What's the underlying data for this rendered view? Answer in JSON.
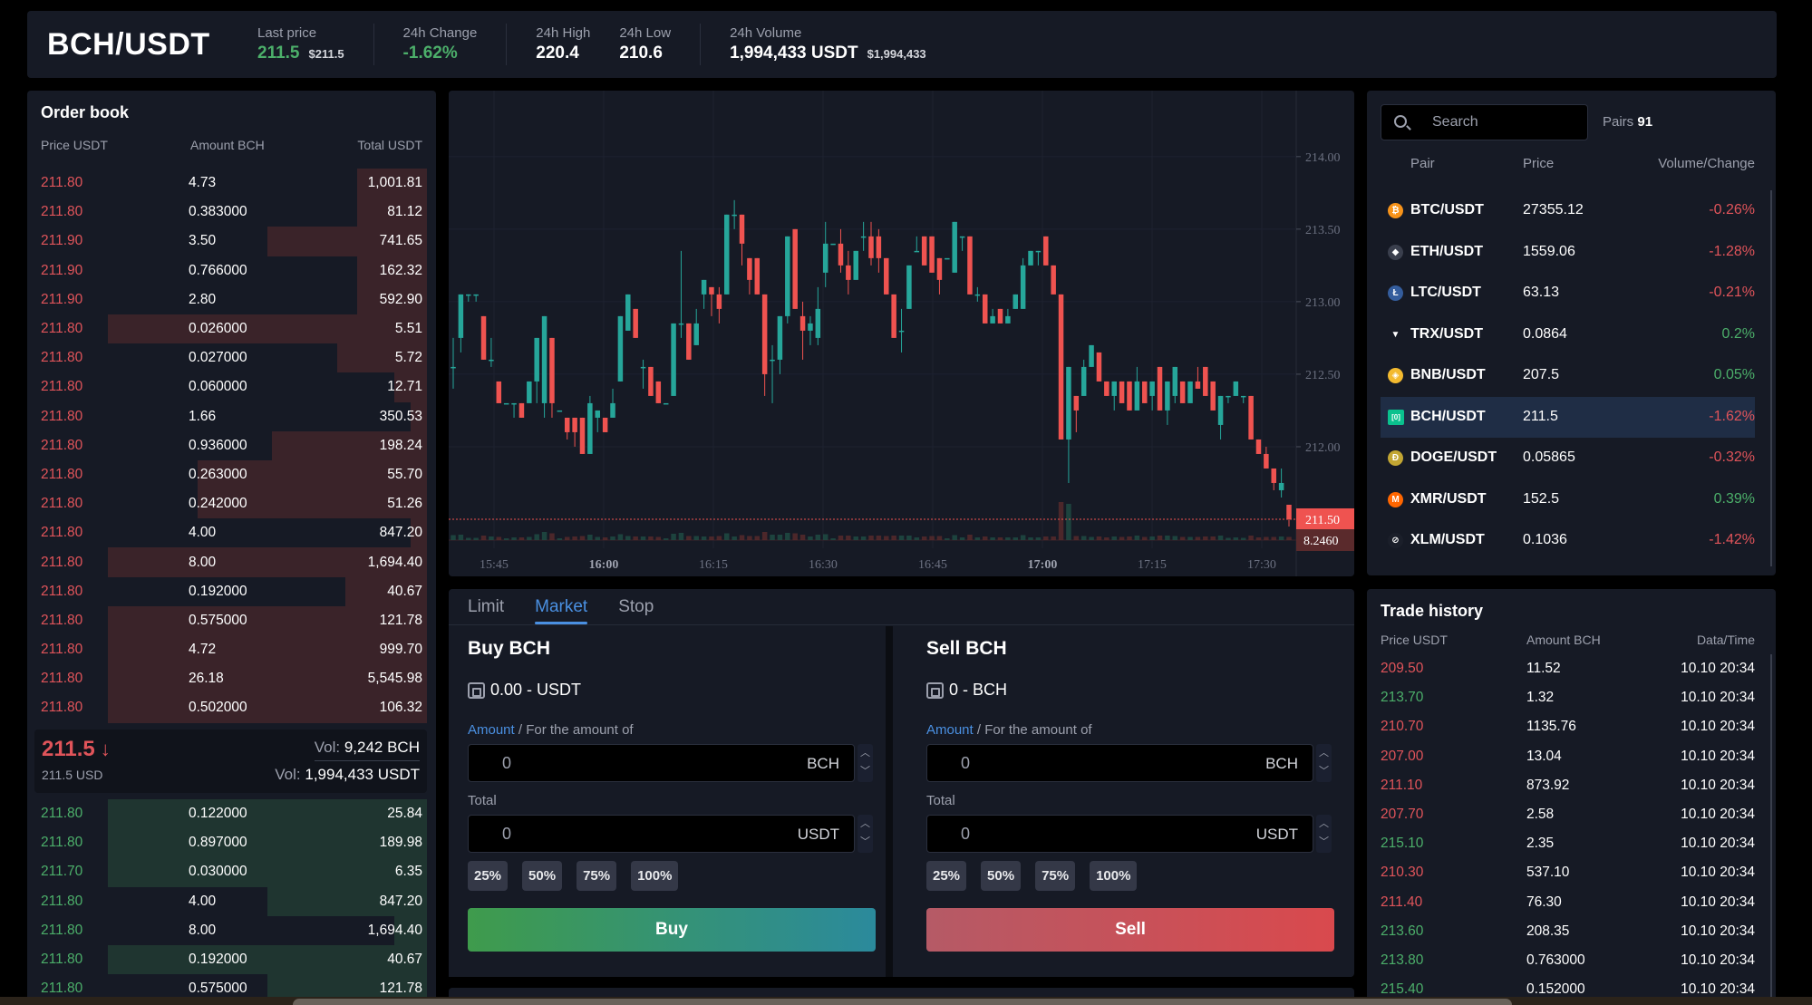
{
  "header": {
    "pair": "BCH/USDT",
    "stats": [
      {
        "label": "Last price",
        "value": "211.5",
        "sub": "$211.5",
        "color": "green"
      },
      {
        "label": "24h Change",
        "value": "-1.62%",
        "sub": "",
        "color": "green"
      },
      {
        "label": "24h High",
        "value": "220.4",
        "sub": "",
        "color": ""
      },
      {
        "label": "24h Low",
        "value": "210.6",
        "sub": "",
        "color": ""
      },
      {
        "label": "24h Volume",
        "value": "1,994,433 USDT",
        "sub": "$1,994,433",
        "color": ""
      }
    ]
  },
  "orderbook": {
    "title": "Order book",
    "columns": [
      "Price USDT",
      "Amount BCH",
      "Total USDT"
    ],
    "asks": [
      {
        "price": "211.80",
        "amount": "4.73",
        "total": "1,001.81",
        "depth": 0.17
      },
      {
        "price": "211.80",
        "amount": "0.383000",
        "total": "81.12",
        "depth": 0.17
      },
      {
        "price": "211.90",
        "amount": "3.50",
        "total": "741.65",
        "depth": 0.39
      },
      {
        "price": "211.90",
        "amount": "0.766000",
        "total": "162.32",
        "depth": 0.17
      },
      {
        "price": "211.90",
        "amount": "2.80",
        "total": "592.90",
        "depth": 0.17
      },
      {
        "price": "211.80",
        "amount": "0.026000",
        "total": "5.51",
        "depth": 0.78
      },
      {
        "price": "211.80",
        "amount": "0.027000",
        "total": "5.72",
        "depth": 0.22
      },
      {
        "price": "211.80",
        "amount": "0.060000",
        "total": "12.71",
        "depth": 0.08
      },
      {
        "price": "211.80",
        "amount": "1.66",
        "total": "350.53",
        "depth": 0.04
      },
      {
        "price": "211.80",
        "amount": "0.936000",
        "total": "198.24",
        "depth": 0.38
      },
      {
        "price": "211.80",
        "amount": "0.263000",
        "total": "55.70",
        "depth": 0.56
      },
      {
        "price": "211.80",
        "amount": "0.242000",
        "total": "51.26",
        "depth": 0.56
      },
      {
        "price": "211.80",
        "amount": "4.00",
        "total": "847.20",
        "depth": 0.04
      },
      {
        "price": "211.80",
        "amount": "8.00",
        "total": "1,694.40",
        "depth": 0.78
      },
      {
        "price": "211.80",
        "amount": "0.192000",
        "total": "40.67",
        "depth": 0.2
      },
      {
        "price": "211.80",
        "amount": "0.575000",
        "total": "121.78",
        "depth": 0.78
      },
      {
        "price": "211.80",
        "amount": "4.72",
        "total": "999.70",
        "depth": 0.78
      },
      {
        "price": "211.80",
        "amount": "26.18",
        "total": "5,545.98",
        "depth": 0.78
      },
      {
        "price": "211.80",
        "amount": "0.502000",
        "total": "106.32",
        "depth": 0.78
      }
    ],
    "mid": {
      "price": "211.5",
      "arrow": "↓",
      "usd": "211.5 USD",
      "vol_label": "Vol:",
      "vol_base": "9,242 BCH",
      "vol_quote": "1,994,433 USDT"
    },
    "bids": [
      {
        "price": "211.80",
        "amount": "0.122000",
        "total": "25.84",
        "depth": 0.78
      },
      {
        "price": "211.80",
        "amount": "0.897000",
        "total": "189.98",
        "depth": 0.78
      },
      {
        "price": "211.70",
        "amount": "0.030000",
        "total": "6.35",
        "depth": 0.78
      },
      {
        "price": "211.80",
        "amount": "4.00",
        "total": "847.20",
        "depth": 0.39
      },
      {
        "price": "211.80",
        "amount": "8.00",
        "total": "1,694.40",
        "depth": 0.08
      },
      {
        "price": "211.80",
        "amount": "0.192000",
        "total": "40.67",
        "depth": 0.78
      },
      {
        "price": "211.80",
        "amount": "0.575000",
        "total": "121.78",
        "depth": 0.39
      }
    ]
  },
  "chart_data": {
    "type": "candlestick",
    "title": "BCH/USDT",
    "x_ticks": [
      "15:45",
      "16:00",
      "16:15",
      "16:30",
      "16:45",
      "17:00",
      "17:15",
      "17:30"
    ],
    "y_ticks": [
      "214.00",
      "213.50",
      "213.00",
      "212.50",
      "212.00"
    ],
    "ylim": [
      211.3,
      214.3
    ],
    "last_price_label": "211.50",
    "last_price": 211.5,
    "volume_label": "8.2460",
    "up_color": "#26a69a",
    "down_color": "#ef5350",
    "candles": [
      [
        212.55,
        212.75,
        212.55,
        212.4
      ],
      [
        212.75,
        213.05,
        213.05,
        212.65
      ],
      [
        213.05,
        213.05,
        213.05,
        213.0
      ],
      [
        213.05,
        213.05,
        213.05,
        213.0
      ],
      [
        212.9,
        212.9,
        212.6,
        212.6
      ],
      [
        212.6,
        212.75,
        212.6,
        212.55
      ],
      [
        212.45,
        212.45,
        212.3,
        212.3
      ],
      [
        212.3,
        212.3,
        212.3,
        212.3
      ],
      [
        212.3,
        212.3,
        212.3,
        212.2
      ],
      [
        212.3,
        212.3,
        212.2,
        212.2
      ],
      [
        212.3,
        212.45,
        212.45,
        212.3
      ],
      [
        212.45,
        212.6,
        212.75,
        212.3
      ],
      [
        212.3,
        212.9,
        212.9,
        212.2
      ],
      [
        212.75,
        212.75,
        212.3,
        212.2
      ],
      [
        212.25,
        212.25,
        212.25,
        212.25
      ],
      [
        212.2,
        212.2,
        212.1,
        212.05
      ],
      [
        212.2,
        212.2,
        212.1,
        212.0
      ],
      [
        212.2,
        212.2,
        211.95,
        211.95
      ],
      [
        211.95,
        212.35,
        212.3,
        211.95
      ],
      [
        212.2,
        212.2,
        212.25,
        212.1
      ],
      [
        212.2,
        212.2,
        212.1,
        212.1
      ],
      [
        212.2,
        212.4,
        212.3,
        212.2
      ],
      [
        212.45,
        212.8,
        212.9,
        212.45
      ],
      [
        212.8,
        212.95,
        213.05,
        212.8
      ],
      [
        212.95,
        212.95,
        212.75,
        212.75
      ],
      [
        212.55,
        212.6,
        212.55,
        212.4
      ],
      [
        212.55,
        212.55,
        212.35,
        212.35
      ],
      [
        212.45,
        212.45,
        212.3,
        212.3
      ],
      [
        212.3,
        212.3,
        212.3,
        212.3
      ],
      [
        212.35,
        212.85,
        212.85,
        212.35
      ],
      [
        212.85,
        213.35,
        212.85,
        212.75
      ],
      [
        212.85,
        212.85,
        212.6,
        212.6
      ],
      [
        212.7,
        212.95,
        212.85,
        212.7
      ],
      [
        213.05,
        213.05,
        213.15,
        212.95
      ],
      [
        213.1,
        213.1,
        213.05,
        212.9
      ],
      [
        213.05,
        213.1,
        212.95,
        212.85
      ],
      [
        213.05,
        213.6,
        213.6,
        213.05
      ],
      [
        213.6,
        213.7,
        213.6,
        213.5
      ],
      [
        213.6,
        213.6,
        213.4,
        213.25
      ],
      [
        213.3,
        213.3,
        213.15,
        213.05
      ],
      [
        213.3,
        213.3,
        213.05,
        213.05
      ],
      [
        213.05,
        213.05,
        212.5,
        212.35
      ],
      [
        212.6,
        212.7,
        212.6,
        212.3
      ],
      [
        212.6,
        212.6,
        212.9,
        212.5
      ],
      [
        212.9,
        213.45,
        213.45,
        212.85
      ],
      [
        213.5,
        213.5,
        212.95,
        212.95
      ],
      [
        212.9,
        213.0,
        212.8,
        212.6
      ],
      [
        212.8,
        212.9,
        212.85,
        212.7
      ],
      [
        212.75,
        213.1,
        212.95,
        212.7
      ],
      [
        213.2,
        213.55,
        213.4,
        213.1
      ],
      [
        213.4,
        213.4,
        213.4,
        213.4
      ],
      [
        213.4,
        213.5,
        213.25,
        213.2
      ],
      [
        213.25,
        213.35,
        213.15,
        213.05
      ],
      [
        213.15,
        213.35,
        213.35,
        213.15
      ],
      [
        213.45,
        213.55,
        213.45,
        213.35
      ],
      [
        213.45,
        213.55,
        213.3,
        213.25
      ],
      [
        213.45,
        213.5,
        213.3,
        213.2
      ],
      [
        213.3,
        213.3,
        213.05,
        213.05
      ],
      [
        213.05,
        213.05,
        212.75,
        212.75
      ],
      [
        212.8,
        212.95,
        212.8,
        212.65
      ],
      [
        212.95,
        213.25,
        213.25,
        212.95
      ],
      [
        213.35,
        213.45,
        213.35,
        213.35
      ],
      [
        213.45,
        213.45,
        213.25,
        213.25
      ],
      [
        213.45,
        213.45,
        213.2,
        213.2
      ],
      [
        213.3,
        213.3,
        213.15,
        213.05
      ],
      [
        213.3,
        213.3,
        213.3,
        213.3
      ],
      [
        213.2,
        213.55,
        213.55,
        213.2
      ],
      [
        213.45,
        213.45,
        213.45,
        213.35
      ],
      [
        213.45,
        213.45,
        213.05,
        213.05
      ],
      [
        213.05,
        213.1,
        213.05,
        213.0
      ],
      [
        213.05,
        213.05,
        212.85,
        212.85
      ],
      [
        212.85,
        212.95,
        212.9,
        212.85
      ],
      [
        212.95,
        212.95,
        212.85,
        212.85
      ],
      [
        212.85,
        212.95,
        212.9,
        212.85
      ],
      [
        212.95,
        213.05,
        213.05,
        212.95
      ],
      [
        212.95,
        213.3,
        213.25,
        212.95
      ],
      [
        213.25,
        213.35,
        213.35,
        213.25
      ],
      [
        213.35,
        213.35,
        213.35,
        213.25
      ],
      [
        213.45,
        213.45,
        213.25,
        213.25
      ],
      [
        213.25,
        213.25,
        213.05,
        213.05
      ],
      [
        213.05,
        213.05,
        212.05,
        212.05
      ],
      [
        212.05,
        212.35,
        212.55,
        211.75
      ],
      [
        212.35,
        212.35,
        212.25,
        212.1
      ],
      [
        212.35,
        212.6,
        212.55,
        212.35
      ],
      [
        212.55,
        212.7,
        212.7,
        212.55
      ],
      [
        212.65,
        212.65,
        212.45,
        212.45
      ],
      [
        212.45,
        212.45,
        212.35,
        212.35
      ],
      [
        212.35,
        212.45,
        212.45,
        212.25
      ],
      [
        212.45,
        212.45,
        212.3,
        212.3
      ],
      [
        212.45,
        212.45,
        212.25,
        212.25
      ],
      [
        212.25,
        212.55,
        212.45,
        212.25
      ],
      [
        212.45,
        212.45,
        212.3,
        212.3
      ],
      [
        212.35,
        212.45,
        212.45,
        212.25
      ],
      [
        212.55,
        212.55,
        212.25,
        212.25
      ],
      [
        212.25,
        212.25,
        212.45,
        212.15
      ],
      [
        212.35,
        212.55,
        212.55,
        212.3
      ],
      [
        212.45,
        212.45,
        212.3,
        212.3
      ],
      [
        212.3,
        212.45,
        212.45,
        212.3
      ],
      [
        212.45,
        212.55,
        212.4,
        212.4
      ],
      [
        212.55,
        212.55,
        212.35,
        212.35
      ],
      [
        212.45,
        212.45,
        212.25,
        212.25
      ],
      [
        212.15,
        212.35,
        212.35,
        212.05
      ],
      [
        212.35,
        212.35,
        212.35,
        212.3
      ],
      [
        212.35,
        212.45,
        212.45,
        212.35
      ],
      [
        212.35,
        212.35,
        212.35,
        212.3
      ],
      [
        212.35,
        212.35,
        212.05,
        212.05
      ],
      [
        212.05,
        212.05,
        211.95,
        211.95
      ],
      [
        211.95,
        212.0,
        211.85,
        211.85
      ],
      [
        211.85,
        211.85,
        211.75,
        211.7
      ],
      [
        211.7,
        211.85,
        211.75,
        211.65
      ],
      [
        211.6,
        211.6,
        211.5,
        211.45
      ]
    ]
  },
  "orderform": {
    "tabs": [
      "Limit",
      "Market",
      "Stop"
    ],
    "active_tab": "Market",
    "buy": {
      "title": "Buy BCH",
      "balance": "0.00 - USDT",
      "amount_label_hl": "Amount",
      "amount_label_rest": " / For the amount of",
      "amount_value": "0",
      "amount_unit": "BCH",
      "total_label": "Total",
      "total_value": "0",
      "total_unit": "USDT",
      "pcts": [
        "25%",
        "50%",
        "75%",
        "100%"
      ],
      "button": "Buy"
    },
    "sell": {
      "title": "Sell BCH",
      "balance": "0 - BCH",
      "amount_label_hl": "Amount",
      "amount_label_rest": " / For the amount of",
      "amount_value": "0",
      "amount_unit": "BCH",
      "total_label": "Total",
      "total_value": "0",
      "total_unit": "USDT",
      "pcts": [
        "25%",
        "50%",
        "75%",
        "100%"
      ],
      "button": "Sell"
    }
  },
  "pairs": {
    "search_placeholder": "Search",
    "count_label": "Pairs",
    "count": "91",
    "columns": [
      "Pair",
      "Price",
      "Volume/Change"
    ],
    "items": [
      {
        "pair": "BTC/USDT",
        "price": "27355.12",
        "change": "-0.26%",
        "dir": "down",
        "icon": "bitcoin-icon",
        "icon_color": "#f7931a",
        "glyph": "₿"
      },
      {
        "pair": "ETH/USDT",
        "price": "1559.06",
        "change": "-1.28%",
        "dir": "down",
        "icon": "ethereum-icon",
        "icon_color": "#3a3f4d",
        "glyph": "◆"
      },
      {
        "pair": "LTC/USDT",
        "price": "63.13",
        "change": "-0.21%",
        "dir": "down",
        "icon": "litecoin-icon",
        "icon_color": "#345d9d",
        "glyph": "Ł"
      },
      {
        "pair": "TRX/USDT",
        "price": "0.0864",
        "change": "0.2%",
        "dir": "up",
        "icon": "tron-icon",
        "icon_color": "#161a25",
        "glyph": "▼"
      },
      {
        "pair": "BNB/USDT",
        "price": "207.5",
        "change": "0.05%",
        "dir": "up",
        "icon": "bnb-icon",
        "icon_color": "#f3ba2f",
        "glyph": "◈"
      },
      {
        "pair": "BCH/USDT",
        "price": "211.5",
        "change": "-1.62%",
        "dir": "down",
        "icon": "bitcoin-cash-icon",
        "icon_color": "#0ac18e",
        "glyph": "[0]",
        "selected": true
      },
      {
        "pair": "DOGE/USDT",
        "price": "0.05865",
        "change": "-0.32%",
        "dir": "down",
        "icon": "dogecoin-icon",
        "icon_color": "#c2a633",
        "glyph": "Ð"
      },
      {
        "pair": "XMR/USDT",
        "price": "152.5",
        "change": "0.39%",
        "dir": "up",
        "icon": "monero-icon",
        "icon_color": "#ff6600",
        "glyph": "M"
      },
      {
        "pair": "XLM/USDT",
        "price": "0.1036",
        "change": "-1.42%",
        "dir": "down",
        "icon": "stellar-icon",
        "icon_color": "#1b1f2a",
        "glyph": "⊘"
      }
    ]
  },
  "trades": {
    "title": "Trade history",
    "columns": [
      "Price USDT",
      "Amount BCH",
      "Data/Time"
    ],
    "rows": [
      {
        "price": "209.50",
        "amount": "11.52",
        "time": "10.10 20:34",
        "dir": "down"
      },
      {
        "price": "213.70",
        "amount": "1.32",
        "time": "10.10 20:34",
        "dir": "up"
      },
      {
        "price": "210.70",
        "amount": "1135.76",
        "time": "10.10 20:34",
        "dir": "down"
      },
      {
        "price": "207.00",
        "amount": "13.04",
        "time": "10.10 20:34",
        "dir": "down"
      },
      {
        "price": "211.10",
        "amount": "873.92",
        "time": "10.10 20:34",
        "dir": "down"
      },
      {
        "price": "207.70",
        "amount": "2.58",
        "time": "10.10 20:34",
        "dir": "down"
      },
      {
        "price": "215.10",
        "amount": "2.35",
        "time": "10.10 20:34",
        "dir": "up"
      },
      {
        "price": "210.30",
        "amount": "537.10",
        "time": "10.10 20:34",
        "dir": "down"
      },
      {
        "price": "211.40",
        "amount": "76.30",
        "time": "10.10 20:34",
        "dir": "down"
      },
      {
        "price": "213.60",
        "amount": "208.35",
        "time": "10.10 20:34",
        "dir": "up"
      },
      {
        "price": "213.80",
        "amount": "0.763000",
        "time": "10.10 20:34",
        "dir": "up"
      },
      {
        "price": "215.40",
        "amount": "0.152000",
        "time": "10.10 20:34",
        "dir": "up"
      }
    ]
  }
}
